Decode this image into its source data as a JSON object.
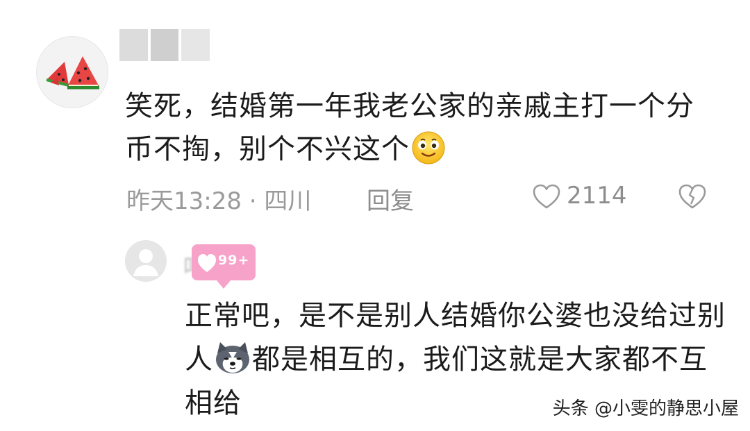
{
  "comment": {
    "text": "笑死，结婚第一年我老公家的亲戚主打一个分币不掏，别个不兴这个",
    "emoji": "smile-emoji",
    "time_location": "昨天13:28 · 四川",
    "reply_label": "回复",
    "like_count": "2114",
    "icons": {
      "like": "heart-outline-icon",
      "dislike": "broken-heart-icon"
    }
  },
  "reply": {
    "username": "吖给",
    "badge_label": "99+",
    "text_before_emoji": "正常吧，是不是别人结婚你公婆也没给过别人",
    "emoji": "husky-dog-emoji",
    "text_after_emoji": "都是相互的，我们这就是大家都不互相给"
  },
  "watermark": "头条 @小雯的静思小屋",
  "colors": {
    "text": "#1b1b1b",
    "meta": "#9a9a9a",
    "badge": "#f7a2c8",
    "watermelon_red": "#e23a3a",
    "watermelon_rind": "#3a9a3a"
  }
}
